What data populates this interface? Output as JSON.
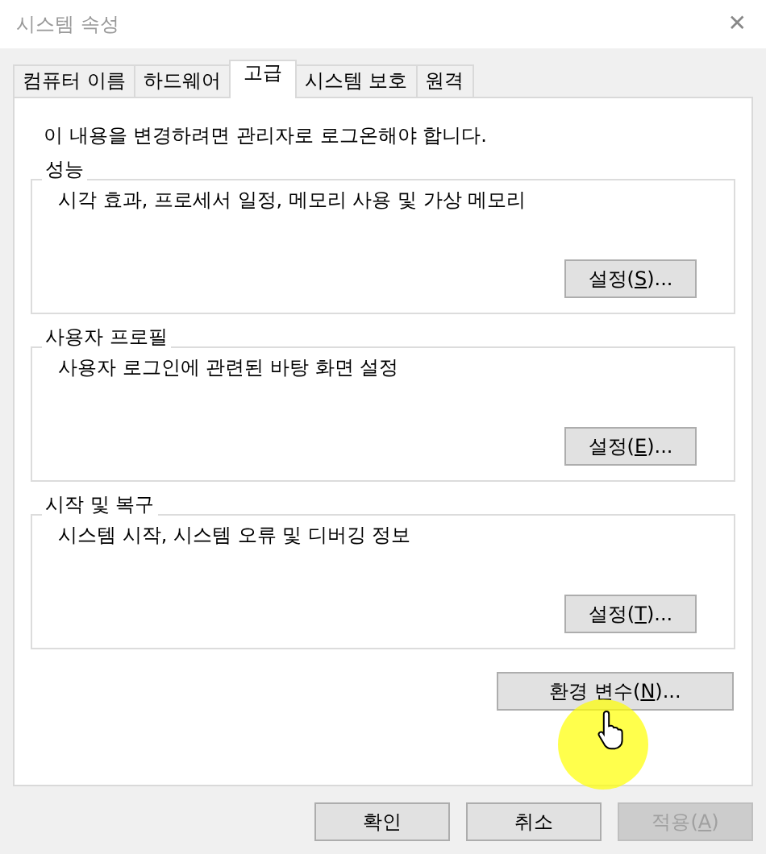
{
  "window": {
    "title": "시스템 속성",
    "close": "✕"
  },
  "tabs": [
    {
      "label": "컴퓨터 이름",
      "selected": false
    },
    {
      "label": "하드웨어",
      "selected": false
    },
    {
      "label": "고급",
      "selected": true
    },
    {
      "label": "시스템 보호",
      "selected": false
    },
    {
      "label": "원격",
      "selected": false
    }
  ],
  "notice": "이 내용을 변경하려면 관리자로 로그온해야 합니다.",
  "groups": [
    {
      "title": "성능",
      "description": "시각 효과, 프로세서 일정, 메모리 사용 및 가상 메모리",
      "button": {
        "before": "설정(",
        "key": "S",
        "after": ")..."
      }
    },
    {
      "title": "사용자 프로필",
      "description": "사용자 로그인에 관련된 바탕 화면 설정",
      "button": {
        "before": "설정(",
        "key": "E",
        "after": ")..."
      }
    },
    {
      "title": "시작 및 복구",
      "description": "시스템 시작, 시스템 오류 및 디버깅 정보",
      "button": {
        "before": "설정(",
        "key": "T",
        "after": ")..."
      }
    }
  ],
  "env_button": {
    "before": "환경 변수(",
    "key": "N",
    "after": ")..."
  },
  "footer_buttons": [
    {
      "before": "확인",
      "disabled": false
    },
    {
      "before": "취소",
      "disabled": false
    },
    {
      "before": "적용(",
      "key": "A",
      "after": ")",
      "disabled": true
    }
  ]
}
